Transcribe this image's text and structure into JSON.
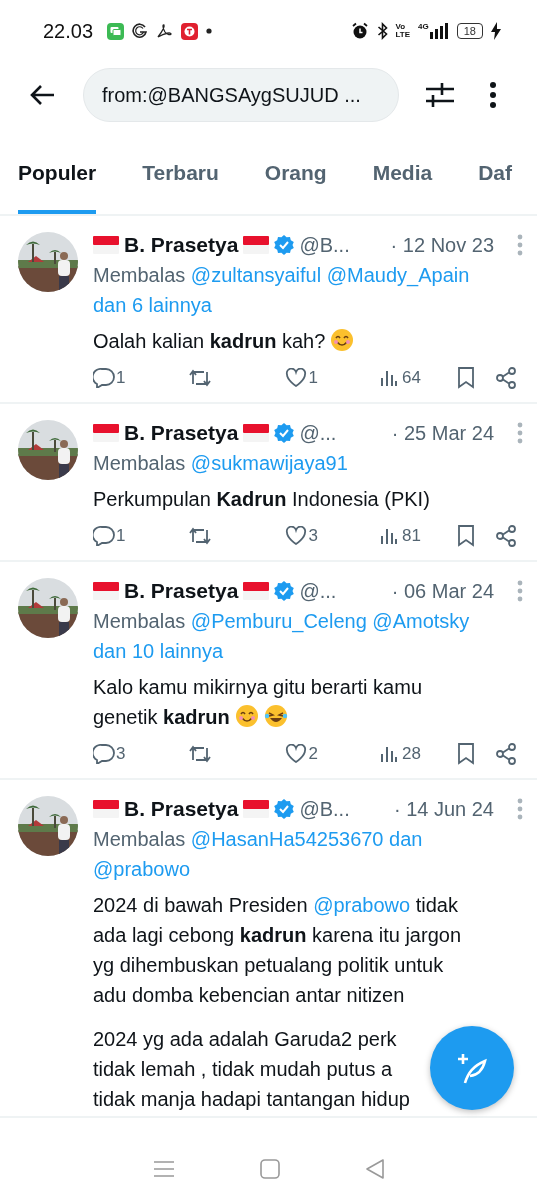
{
  "status_bar": {
    "time": "22.03",
    "apps": [
      {
        "kind": "chat"
      },
      {
        "kind": "g"
      },
      {
        "kind": "acrobat"
      },
      {
        "kind": "t"
      },
      {
        "kind": "dot"
      }
    ],
    "volte_top": "Vo",
    "volte_bottom": "LTE",
    "network": "4G",
    "battery": "18",
    "charging": true
  },
  "search": {
    "value": "from:@BANGSAygSUJUD ..."
  },
  "tabs": [
    {
      "label": "Populer",
      "selected": true
    },
    {
      "label": "Terbaru",
      "selected": false
    },
    {
      "label": "Orang",
      "selected": false
    },
    {
      "label": "Media",
      "selected": false
    },
    {
      "label": "Daf",
      "selected": false
    }
  ],
  "tweets": [
    {
      "name": "B. Prasetya",
      "verified": true,
      "handle": "@B...",
      "date": "· 12 Nov 23",
      "reply_label": "Membalas",
      "mentions": [
        "@zultansyaiful",
        "@Maudy_Apain",
        "dan 6 lainnya"
      ],
      "body": [
        [
          [
            {
              "kind": "text",
              "text": "Oalah kalian "
            },
            {
              "kind": "bold",
              "text": "kadrun"
            },
            {
              "kind": "text",
              "text": " kah?"
            },
            {
              "kind": "smile_emoji"
            }
          ]
        ]
      ],
      "replies": "1",
      "likes": "1",
      "views": "64"
    },
    {
      "name": "B. Prasetya",
      "verified": true,
      "handle": "@...",
      "date": "· 25 Mar 24",
      "reply_label": "Membalas",
      "mentions": [
        "@sukmawijaya91"
      ],
      "body": [
        [
          [
            {
              "kind": "text",
              "text": "Perkumpulan "
            },
            {
              "kind": "bold",
              "text": "Kadrun"
            },
            {
              "kind": "text",
              "text": " Indonesia (PKI)"
            }
          ]
        ]
      ],
      "replies": "1",
      "likes": "3",
      "views": "81"
    },
    {
      "name": "B. Prasetya",
      "verified": true,
      "handle": "@...",
      "date": "· 06 Mar 24",
      "reply_label": "Membalas",
      "mentions": [
        "@Pemburu_Celeng",
        "@Amotsky",
        "dan 10 lainnya"
      ],
      "body": [
        [
          [
            {
              "kind": "text",
              "text": "Kalo kamu mikirnya gitu berarti kamu"
            }
          ],
          [
            {
              "kind": "text",
              "text": "genetik "
            },
            {
              "kind": "bold",
              "text": "kadrun"
            },
            {
              "kind": "smile_emoji"
            },
            {
              "kind": "laugh_emoji"
            }
          ]
        ]
      ],
      "replies": "3",
      "likes": "2",
      "views": "28"
    },
    {
      "name": "B. Prasetya",
      "verified": true,
      "handle": "@B...",
      "date": "· 14 Jun 24",
      "reply_label": "Membalas",
      "mentions": [
        "@HasanHa54253670 dan",
        "@prabowo"
      ],
      "body": [
        [
          [
            {
              "kind": "text",
              "text": "2024 di bawah Presiden "
            },
            {
              "kind": "link",
              "text": "@prabowo"
            },
            {
              "kind": "text",
              "text": " tidak"
            }
          ],
          [
            {
              "kind": "text",
              "text": "ada lagi cebong "
            },
            {
              "kind": "bold",
              "text": "kadrun"
            },
            {
              "kind": "text",
              "text": " karena itu jargon"
            }
          ],
          [
            {
              "kind": "text",
              "text": "yg dihembuskan petualang politik untuk"
            }
          ],
          [
            {
              "kind": "text",
              "text": "adu domba kebencian antar nitizen"
            }
          ]
        ],
        [
          [
            {
              "kind": "text",
              "text": "2024 yg ada adalah Garuda2 perk"
            }
          ],
          [
            {
              "kind": "text",
              "text": "tidak lemah , tidak mudah putus a"
            }
          ],
          [
            {
              "kind": "text",
              "text": "tidak manja hadapi tantangan hidup"
            }
          ]
        ]
      ]
    }
  ]
}
